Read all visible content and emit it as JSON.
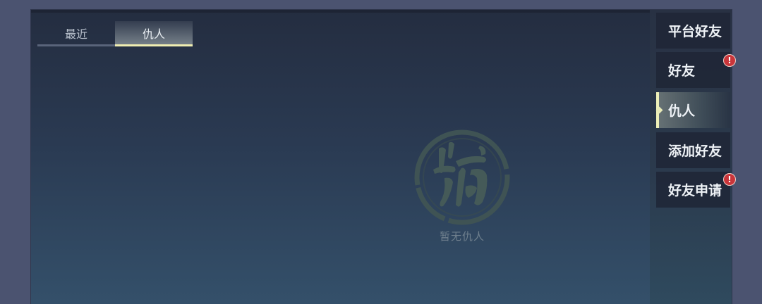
{
  "tabs": [
    {
      "label": "最近",
      "active": false
    },
    {
      "label": "仇人",
      "active": true
    }
  ],
  "empty_state": {
    "text": "暂无仇人",
    "emblem_icon": "ink-brush-seal-icon"
  },
  "sidebar": {
    "items": [
      {
        "label": "平台好友",
        "active": false,
        "badge": ""
      },
      {
        "label": "好友",
        "active": false,
        "badge": "!"
      },
      {
        "label": "仇人",
        "active": true,
        "badge": ""
      },
      {
        "label": "添加好友",
        "active": false,
        "badge": ""
      },
      {
        "label": "好友申请",
        "active": false,
        "badge": "!"
      }
    ]
  },
  "colors": {
    "tab_active_underline": "#f0eeb2",
    "badge": "#c9353a"
  }
}
